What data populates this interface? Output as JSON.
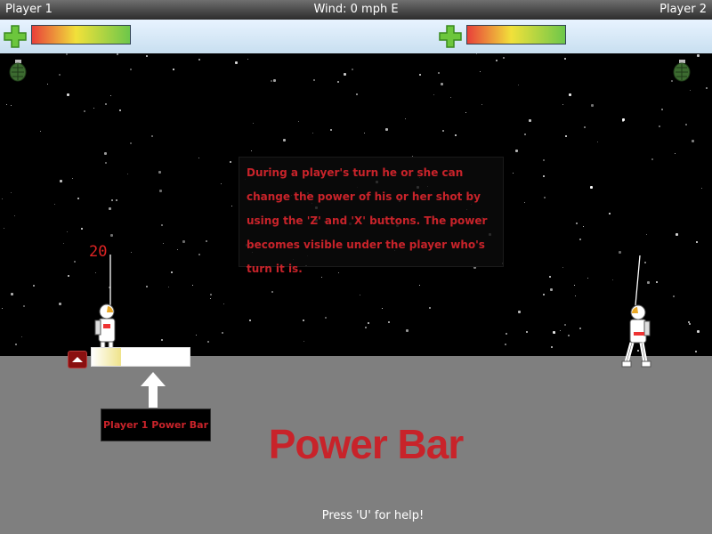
{
  "header": {
    "player1": "Player 1",
    "player2": "Player 2",
    "wind": "Wind: 0 mph E"
  },
  "health": {
    "player1_level": 1.0,
    "player2_level": 1.0
  },
  "info": {
    "text": "During a player's turn he or she can change the power of his or her shot by using the 'Z' and 'X' buttons. The power becomes visible under the player who's turn it is."
  },
  "player1": {
    "power_value": "20",
    "power_level": 0.3
  },
  "labels": {
    "power_bar_label": "Player 1 Power Bar",
    "big_title": "Power Bar",
    "help": "Press 'U' for help!"
  },
  "colors": {
    "title_red": "#c8232a",
    "ground": "#7f7f7f",
    "sky": "#000000"
  },
  "icons": [
    "plus-icon",
    "health-bar",
    "grenade-icon",
    "astronaut",
    "up-arrow-icon"
  ]
}
